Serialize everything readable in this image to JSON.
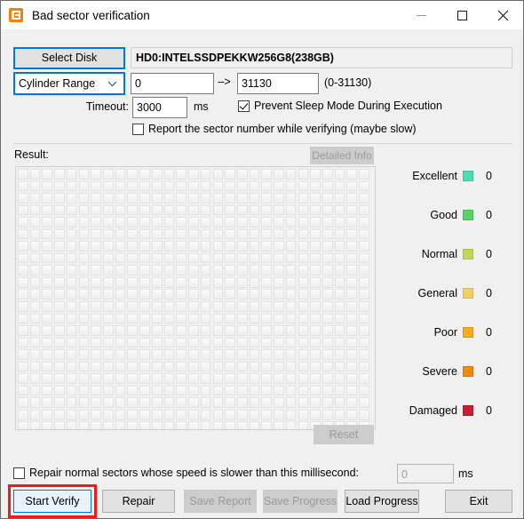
{
  "window": {
    "title": "Bad sector verification",
    "icon": "app-disk-icon",
    "controls": {
      "minimize": "minimize-icon",
      "maximize": "maximize-icon",
      "close": "close-icon"
    }
  },
  "toolbar": {
    "select_disk_label": "Select Disk",
    "disk_name": "HD0:INTELSSDPEKKW256G8(238GB)",
    "range_mode": "Cylinder Range",
    "range_mode_chevron": "chevron-down-icon",
    "range_start": "0",
    "range_arrow": "-->",
    "range_end": "31130",
    "range_hint": "(0-31130)",
    "timeout_label": "Timeout:",
    "timeout_value": "3000",
    "timeout_unit": "ms",
    "prevent_sleep_label": "Prevent Sleep Mode During Execution",
    "prevent_sleep_checked": true,
    "report_sector_label": "Report the sector number while verifying (maybe slow)",
    "report_sector_checked": false
  },
  "result": {
    "label": "Result:",
    "detailed_info_label": "Detailed Info",
    "reset_label": "Reset",
    "grid": {
      "columns": 29,
      "rows": 22
    }
  },
  "legend": {
    "items": [
      {
        "name": "Excellent",
        "color": "#4fd9b5",
        "count": "0"
      },
      {
        "name": "Good",
        "color": "#5cd06a",
        "count": "0"
      },
      {
        "name": "Normal",
        "color": "#bcd95a",
        "count": "0"
      },
      {
        "name": "General",
        "color": "#f0cf6b",
        "count": "0"
      },
      {
        "name": "Poor",
        "color": "#f5ad20",
        "count": "0"
      },
      {
        "name": "Severe",
        "color": "#ef8b13",
        "count": "0"
      },
      {
        "name": "Damaged",
        "color": "#c41e36",
        "count": "0"
      }
    ]
  },
  "bottom": {
    "repair_slow_label": "Repair normal sectors whose speed is slower than this millisecond:",
    "repair_slow_checked": false,
    "repair_ms_value": "0",
    "repair_ms_unit": "ms",
    "buttons": {
      "start_verify": "Start Verify",
      "repair": "Repair",
      "save_report": "Save Report",
      "save_progress": "Save Progress",
      "load_progress": "Load Progress",
      "exit": "Exit"
    }
  },
  "annotation": {
    "highlight_color": "#ee1b1b",
    "target": "start-verify-button"
  }
}
